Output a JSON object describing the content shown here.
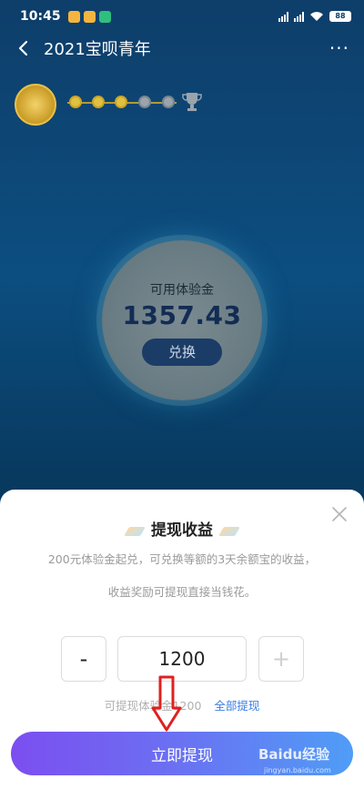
{
  "status_bar": {
    "time": "10:45",
    "battery": "88"
  },
  "nav": {
    "title": "2021宝呗青年",
    "more": "···"
  },
  "balance": {
    "label": "可用体验金",
    "value": "1357.43",
    "exchange_label": "兑换"
  },
  "sheet": {
    "title": "提现收益",
    "desc_line1": "200元体验金起兑，可兑换等额的3天余额宝的收益，",
    "desc_line2": "收益奖励可提现直接当钱花。",
    "minus_label": "-",
    "plus_label": "+",
    "amount_value": "1200",
    "available_text": "可提现体验金1200",
    "withdraw_all_label": "全部提现",
    "submit_label": "立即提现"
  },
  "watermark": {
    "brand": "Baidu经验",
    "url": "jingyan.baidu.com"
  },
  "colors": {
    "accent_start": "#7c4ef0",
    "accent_end": "#4f9df6",
    "link": "#3b7ee6",
    "balance_text": "#122c54"
  }
}
